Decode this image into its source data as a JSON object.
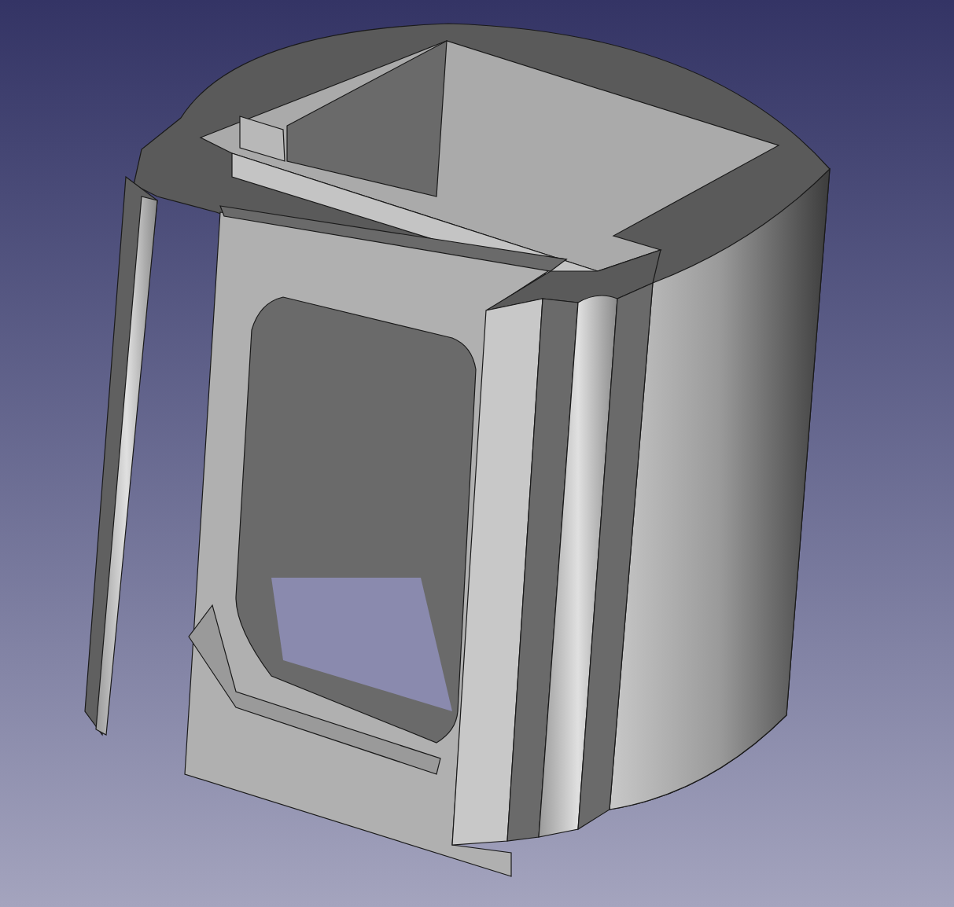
{
  "viewport": {
    "kind": "solid"
  }
}
